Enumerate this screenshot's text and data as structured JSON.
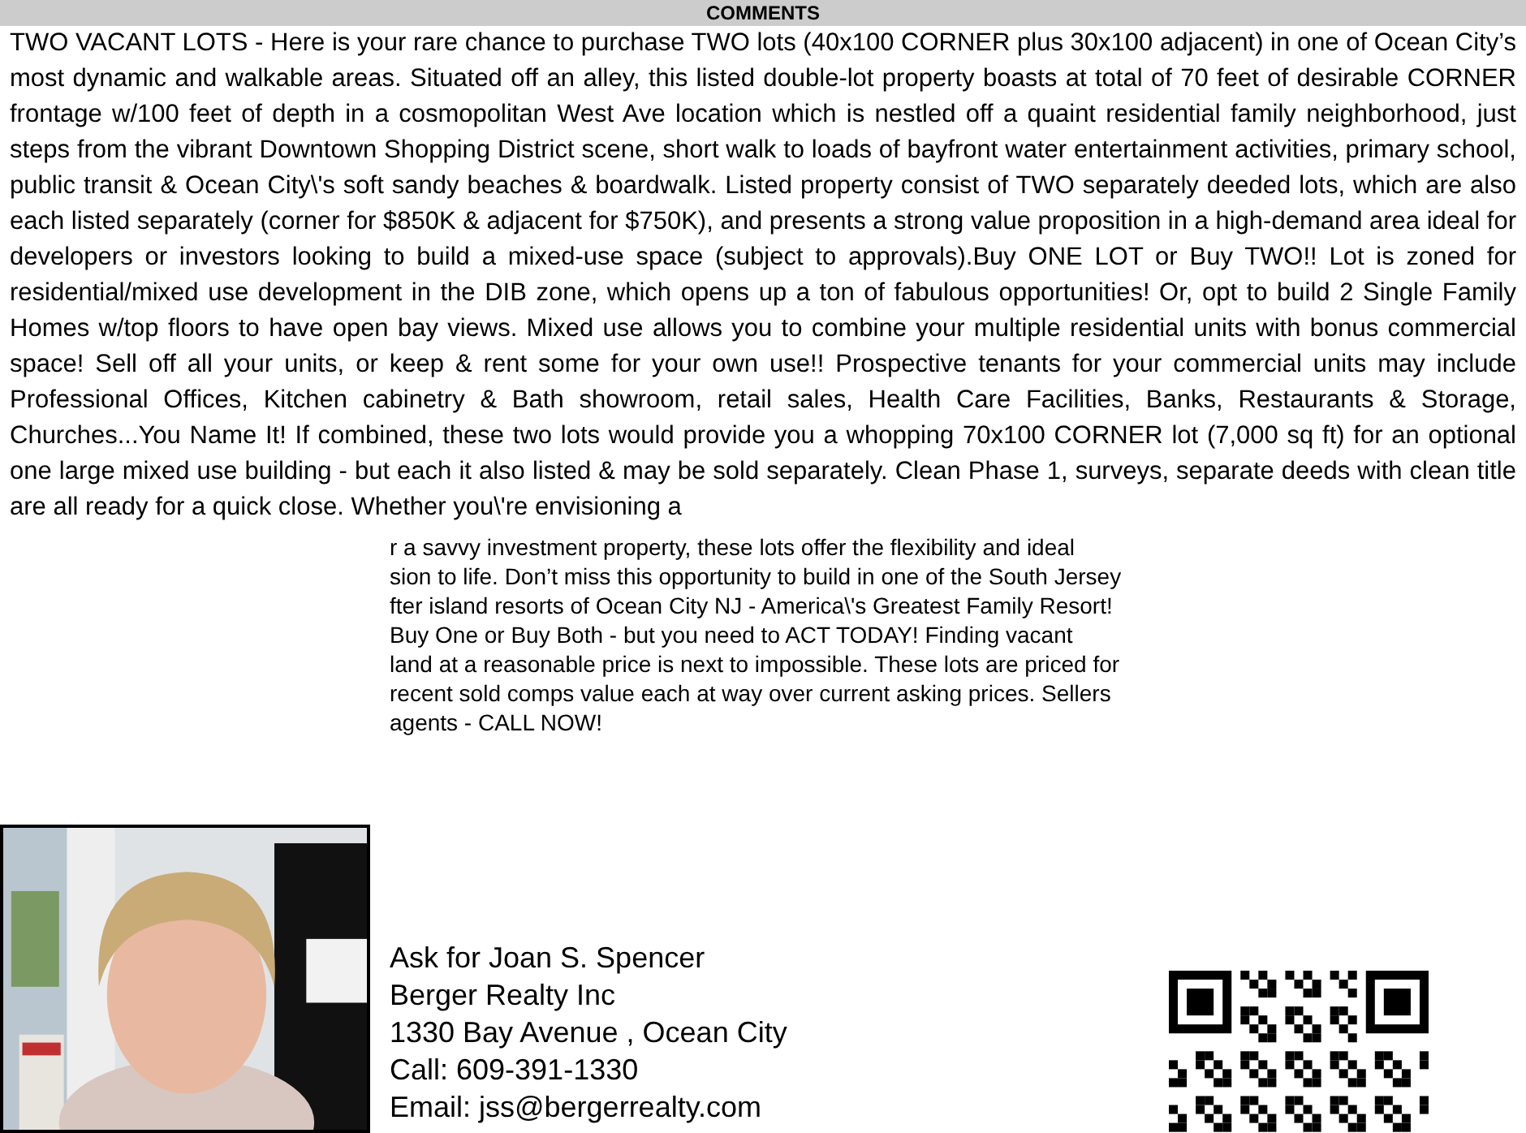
{
  "section_title": "COMMENTS",
  "comments": "TWO VACANT LOTS - Here is your rare chance to purchase TWO lots (40x100 CORNER plus 30x100 adjacent) in one of Ocean City’s most dynamic and walkable areas. Situated off an alley, this listed double-lot property boasts at total of 70 feet of desirable CORNER frontage w/100 feet of depth in a cosmopolitan West Ave location which is nestled off a quaint residential family neighborhood, just steps from the vibrant Downtown Shopping District scene, short walk to loads of bayfront water entertainment activities, primary school, public transit & Ocean City\\'s soft sandy beaches & boardwalk. Listed property consist of TWO separately deeded lots, which are also each listed separately (corner for $850K & adjacent for $750K), and presents a strong value proposition in a high-demand area ideal for developers or investors looking to build a mixed-use space (subject to approvals).Buy ONE LOT or Buy TWO!! Lot is zoned for residential/mixed use development in the DIB zone, which opens up a ton of fabulous opportunities! Or, opt to build 2 Single Family Homes w/top floors to have open bay views. Mixed use allows you to combine your multiple residential units with bonus commercial space! Sell off all your units, or keep & rent some for your own use!! Prospective tenants for your commercial units may include Professional Offices, Kitchen cabinetry & Bath showroom, retail sales, Health Care Facilities, Banks, Restaurants & Storage, Churches...You Name It! If combined, these two lots would provide you a whopping 70x100 CORNER lot (7,000 sq ft) for an optional one large mixed use building - but each it also listed & may be sold separately. Clean Phase 1, surveys, separate deeds with clean title are all ready for a quick close. Whether you\\'re envisioning a",
  "comments_continued": [
    "r a savvy investment property, these lots offer the flexibility and ideal",
    "sion to life. Don’t miss this opportunity to build in one of the South Jersey",
    "fter island resorts of Ocean City NJ - America\\'s Greatest Family Resort!",
    "Buy One or Buy Both - but you need to ACT TODAY! Finding vacant",
    "land at a reasonable price is next to impossible. These lots are priced for",
    "recent sold comps value each at way over current asking prices. Sellers",
    "agents - CALL NOW!"
  ],
  "contact": [
    "Ask for Joan S. Spencer",
    "Berger Realty Inc",
    "1330 Bay Avenue , Ocean City",
    "Call: 609-391-1330",
    "Email: jss@bergerrealty.com"
  ]
}
